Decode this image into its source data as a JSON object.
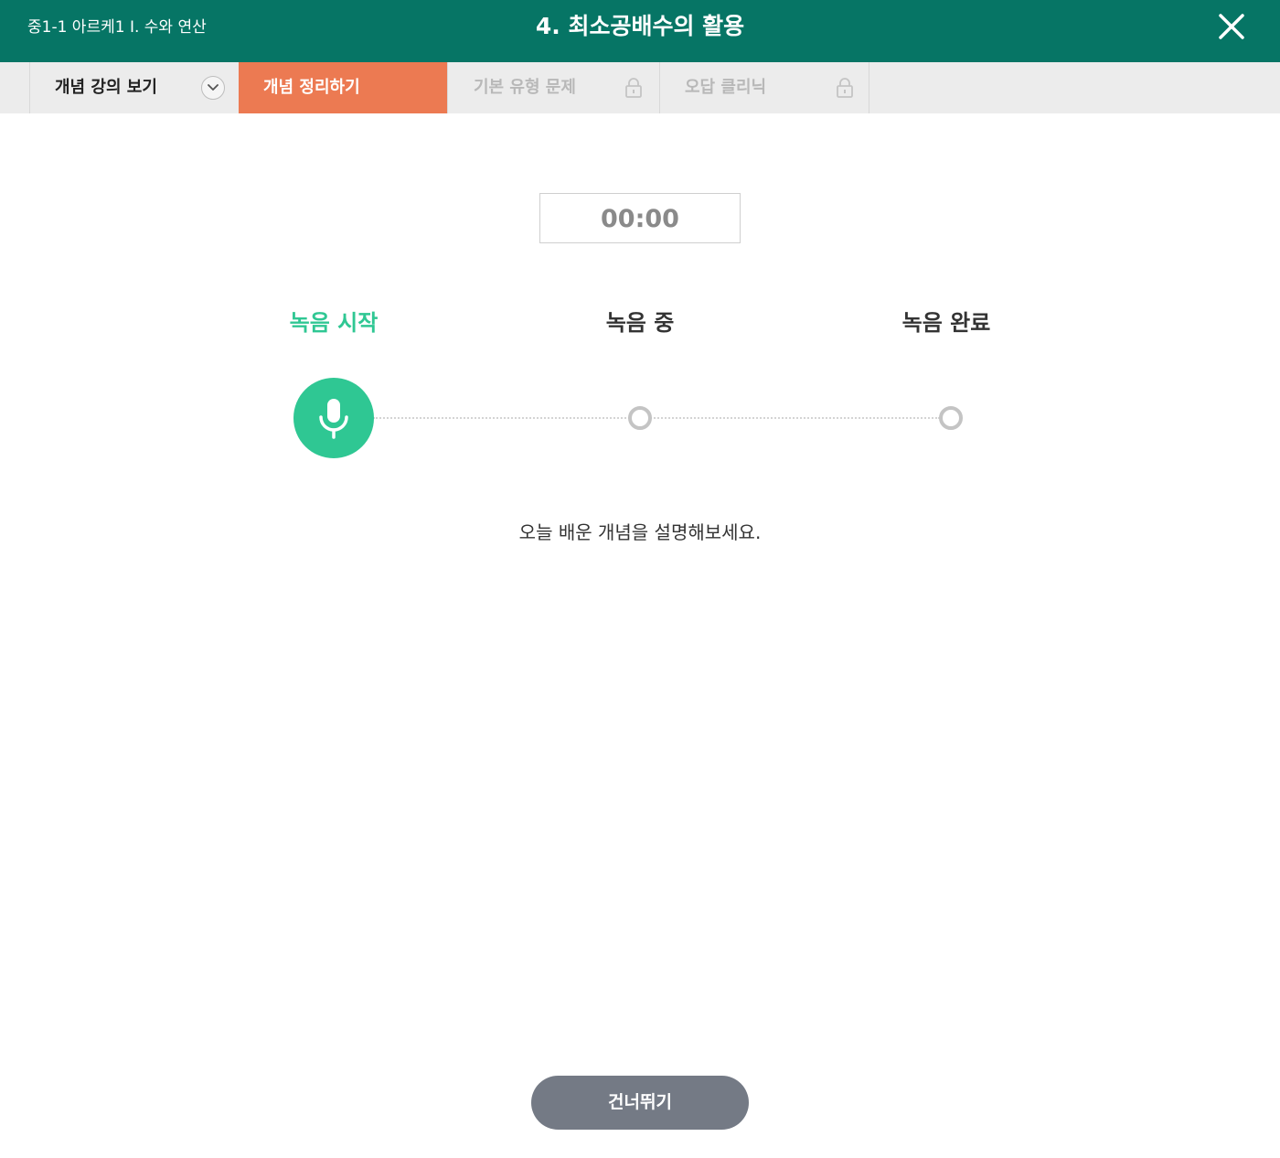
{
  "header": {
    "breadcrumb": "중1-1 아르케1  Ⅰ. 수와 연산",
    "title": "4. 최소공배수의 활용",
    "close_icon": "close-icon"
  },
  "tabs": [
    {
      "label": "개념 강의 보기",
      "state": "default",
      "icon": "chevron-down-icon"
    },
    {
      "label": "개념 정리하기",
      "state": "active"
    },
    {
      "label": "기본 유형 문제",
      "state": "locked",
      "icon": "lock-icon"
    },
    {
      "label": "오답 클리닉",
      "state": "locked",
      "icon": "lock-icon"
    }
  ],
  "recorder": {
    "timer": "00:00",
    "steps": [
      {
        "label": "녹음 시작",
        "state": "current"
      },
      {
        "label": "녹음 중",
        "state": "pending"
      },
      {
        "label": "녹음 완료",
        "state": "pending"
      }
    ],
    "mic_icon": "microphone-icon",
    "instruction": "오늘 배운 개념을 설명해보세요."
  },
  "footer": {
    "skip_label": "건너뛰기"
  },
  "colors": {
    "header_bg": "#067565",
    "active_tab": "#ec7a52",
    "accent_green": "#2fc793",
    "skip_button": "#747a85"
  }
}
